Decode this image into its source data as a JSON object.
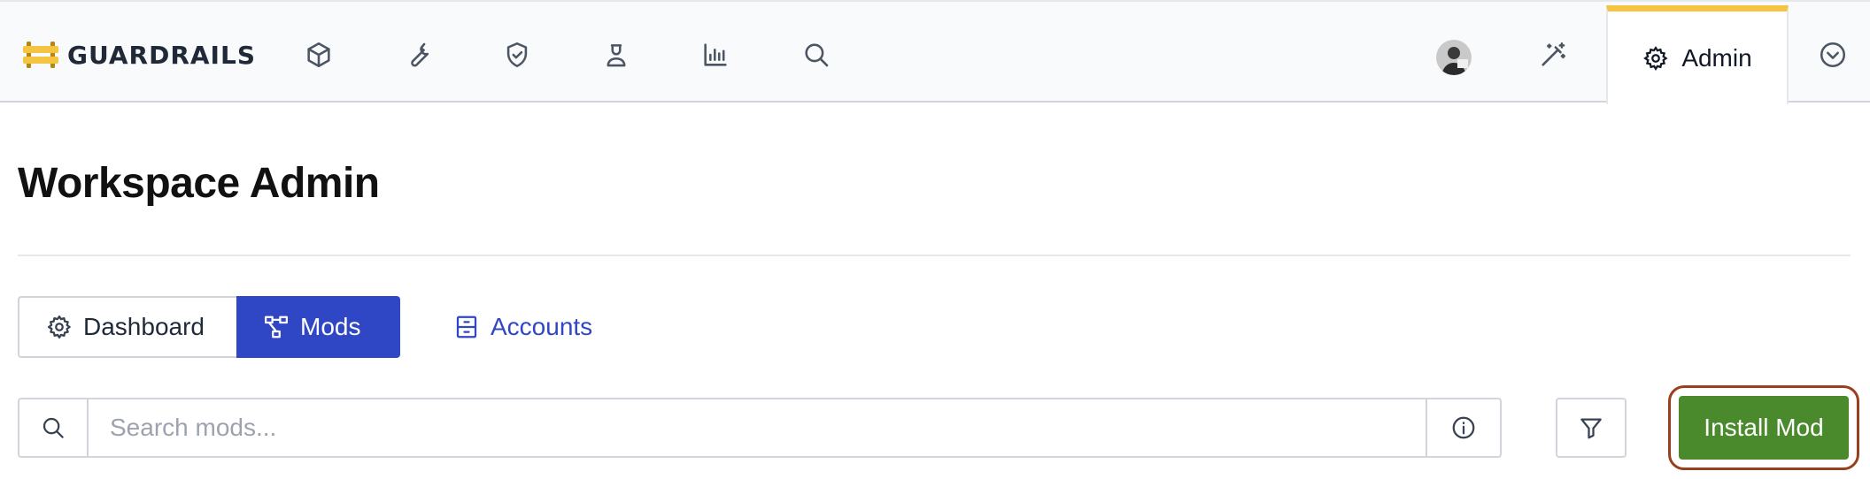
{
  "brand": {
    "name": "GUARDRAILS",
    "logo_color": "#f6c443"
  },
  "nav": {
    "icons": [
      "cube-icon",
      "wrench-icon",
      "shield-check-icon",
      "user-icon",
      "bar-chart-icon",
      "search-icon"
    ],
    "right_icons": [
      "avatar",
      "magic-wand-icon"
    ],
    "active_tab": {
      "label": "Admin",
      "icon": "gear-icon"
    },
    "menu_icon": "chevron-down-circle-icon",
    "active_accent": "#f6c443"
  },
  "page": {
    "title": "Workspace Admin"
  },
  "tabs": [
    {
      "label": "Dashboard",
      "icon": "gear-icon",
      "active": false
    },
    {
      "label": "Mods",
      "icon": "hierarchy-icon",
      "active": true
    },
    {
      "label": "Accounts",
      "icon": "cabinet-icon",
      "active": false
    }
  ],
  "search": {
    "placeholder": "Search mods...",
    "value": ""
  },
  "actions": {
    "install_label": "Install Mod",
    "primary_color": "#2f47c4",
    "install_color": "#4b8a2c",
    "highlight_color": "#9a3f1e"
  }
}
